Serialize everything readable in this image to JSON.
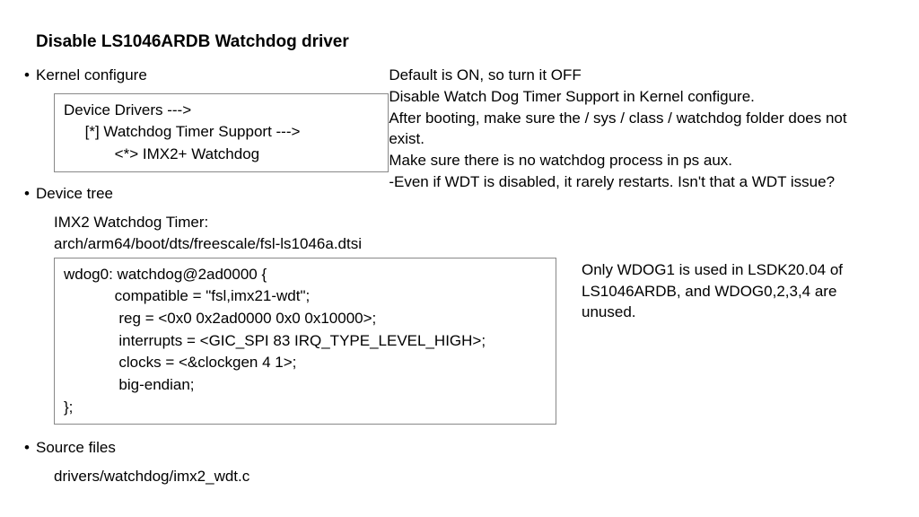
{
  "title": "Disable LS1046ARDB Watchdog driver",
  "sections": {
    "kernel": {
      "label": "Kernel configure",
      "box": "Device Drivers --->\n     [*] Watchdog Timer Support --->\n            <*> IMX2+ Watchdog"
    },
    "devicetree": {
      "label": "Device tree",
      "intro1": "IMX2 Watchdog Timer:",
      "intro2": "arch/arm64/boot/dts/freescale/fsl-ls1046a.dtsi",
      "box": "wdog0: watchdog@2ad0000 {\n            compatible = \"fsl,imx21-wdt\";\n             reg = <0x0 0x2ad0000 0x0 0x10000>;\n             interrupts = <GIC_SPI 83 IRQ_TYPE_LEVEL_HIGH>;\n             clocks = <&clockgen 4 1>;\n             big-endian;\n};"
    },
    "source": {
      "label": "Source files",
      "path": "drivers/watchdog/imx2_wdt.c"
    }
  },
  "notes": {
    "main": "Default is ON, so turn it OFF\nDisable Watch Dog Timer Support in Kernel configure.\nAfter booting, make sure the / sys / class / watchdog folder does not exist.\nMake sure there is no watchdog process in ps aux.\n-Even if WDT is disabled, it rarely restarts. Isn't that a WDT issue?",
    "wdog": "Only WDOG1 is used in LSDK20.04 of LS1046ARDB, and WDOG0,2,3,4 are unused."
  }
}
